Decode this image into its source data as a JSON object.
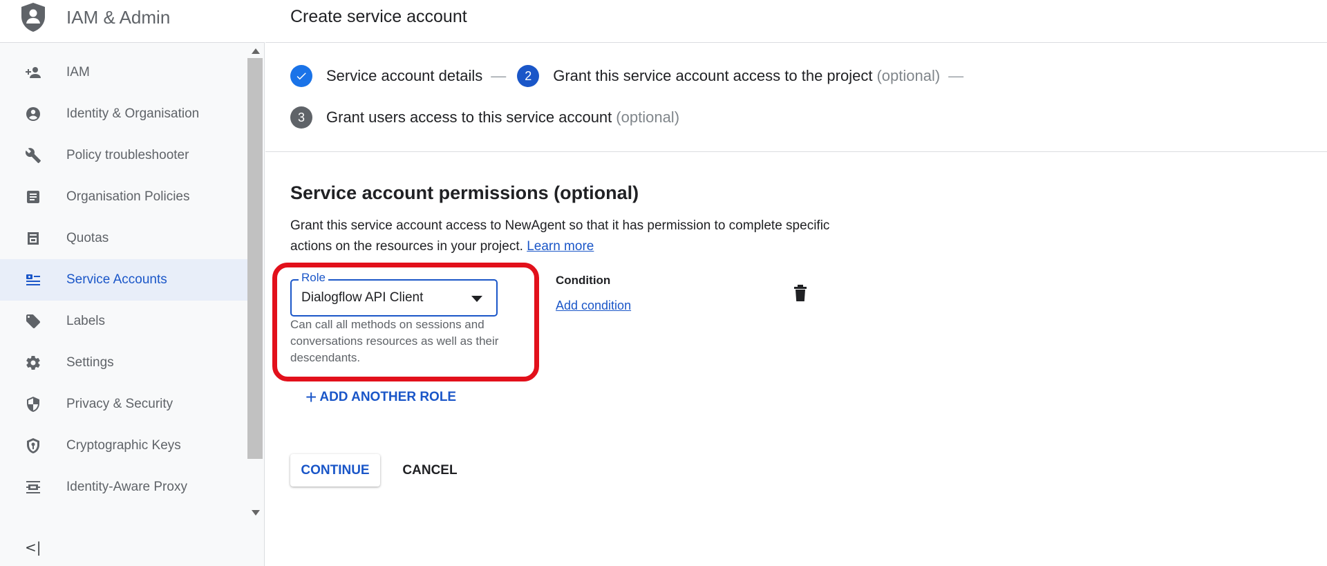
{
  "sidebar": {
    "product_title": "IAM & Admin",
    "items": [
      {
        "label": "IAM",
        "icon": "person-add-icon",
        "active": false
      },
      {
        "label": "Identity & Organisation",
        "icon": "account-circle-icon",
        "active": false
      },
      {
        "label": "Policy troubleshooter",
        "icon": "wrench-icon",
        "active": false
      },
      {
        "label": "Organisation Policies",
        "icon": "article-icon",
        "active": false
      },
      {
        "label": "Quotas",
        "icon": "quota-icon",
        "active": false
      },
      {
        "label": "Service Accounts",
        "icon": "service-account-icon",
        "active": true
      },
      {
        "label": "Labels",
        "icon": "label-tag-icon",
        "active": false
      },
      {
        "label": "Settings",
        "icon": "gear-icon",
        "active": false
      },
      {
        "label": "Privacy & Security",
        "icon": "shield-icon",
        "active": false
      },
      {
        "label": "Cryptographic Keys",
        "icon": "key-shield-icon",
        "active": false
      },
      {
        "label": "Identity-Aware Proxy",
        "icon": "proxy-icon",
        "active": false
      }
    ],
    "collapse_label": "<|"
  },
  "header": {
    "title": "Create service account"
  },
  "stepper": {
    "step1": {
      "label": "Service account details",
      "status": "done"
    },
    "step2": {
      "number": "2",
      "label": "Grant this service account access to the project",
      "optional": "(optional)",
      "status": "current"
    },
    "step3": {
      "number": "3",
      "label": "Grant users access to this service account",
      "optional": "(optional)",
      "status": "pending"
    },
    "separator": "—"
  },
  "permissions": {
    "title": "Service account permissions (optional)",
    "description": "Grant this service account access to NewAgent so that it has permission to complete specific actions on the resources in your project.",
    "learn_more": "Learn more",
    "role": {
      "label": "Role",
      "value": "Dialogflow API Client",
      "hint": "Can call all methods on sessions and conversations resources as well as their descendants."
    },
    "condition": {
      "title": "Condition",
      "add_label": "Add condition"
    },
    "add_another_role": "ADD ANOTHER ROLE",
    "add_plus": "+"
  },
  "actions": {
    "continue_label": "CONTINUE",
    "cancel_label": "CANCEL"
  },
  "colors": {
    "accent": "#1a56c8",
    "highlight": "#e2101b",
    "active_bg": "#e8eef9"
  }
}
